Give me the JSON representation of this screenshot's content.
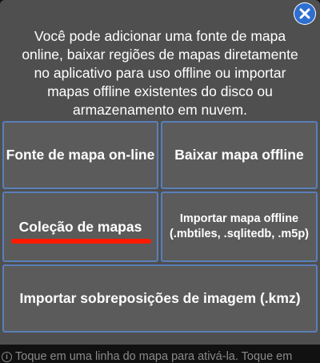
{
  "dialog": {
    "intro": "Você pode adicionar uma fonte de mapa online, baixar regiões de mapas diretamente no aplicativo para uso offline ou importar mapas offline existentes do disco ou armazenamento em nuvem.",
    "options": {
      "online_source": "Fonte de mapa on-line",
      "download_offline": "Baixar mapa offline",
      "map_collection": "Coleção de mapas",
      "import_offline_title": "Importar mapa offline",
      "import_offline_formats": "(.mbtiles, .sqlitedb, .m5p)",
      "import_overlays": "Importar sobreposições de imagem (.kmz)"
    }
  },
  "footer_hint": "Toque em uma linha do mapa para ativá-la. Toque em",
  "icons": {
    "close": "close-icon",
    "info": "info-icon"
  },
  "colors": {
    "dialog_bg": "#4f4f4f",
    "button_border": "#5a7fb8",
    "close_icon": "#2f6fd0",
    "highlight": "#ff1a00"
  }
}
